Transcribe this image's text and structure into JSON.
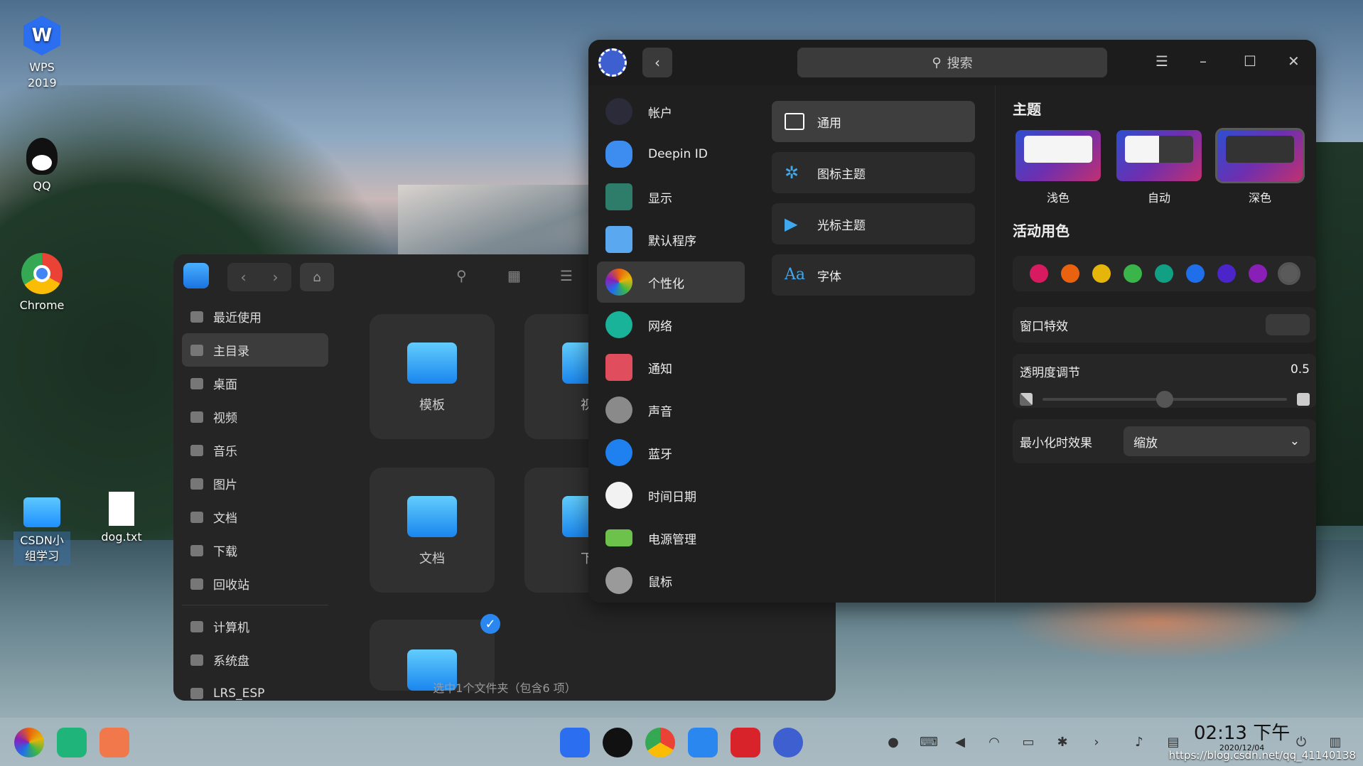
{
  "desktop": {
    "icons": [
      {
        "label": "WPS 2019"
      },
      {
        "label": "QQ"
      },
      {
        "label": "Chrome"
      },
      {
        "label": "CSDN小组学习"
      },
      {
        "label": "dog.txt"
      }
    ]
  },
  "file_manager": {
    "sidebar": [
      {
        "label": "最近使用"
      },
      {
        "label": "主目录"
      },
      {
        "label": "桌面"
      },
      {
        "label": "视频"
      },
      {
        "label": "音乐"
      },
      {
        "label": "图片"
      },
      {
        "label": "文档"
      },
      {
        "label": "下载"
      },
      {
        "label": "回收站"
      },
      {
        "label": "计算机"
      },
      {
        "label": "系统盘"
      },
      {
        "label": "LRS_ESP"
      }
    ],
    "items": [
      {
        "label": "模板"
      },
      {
        "label": "视"
      },
      {
        "label": "文档"
      },
      {
        "label": "下"
      }
    ],
    "status": "选中1个文件夹（包含6 项）"
  },
  "control_center": {
    "search_placeholder": "搜索",
    "nav": [
      {
        "label": "帐户"
      },
      {
        "label": "Deepin ID"
      },
      {
        "label": "显示"
      },
      {
        "label": "默认程序"
      },
      {
        "label": "个性化"
      },
      {
        "label": "网络"
      },
      {
        "label": "通知"
      },
      {
        "label": "声音"
      },
      {
        "label": "蓝牙"
      },
      {
        "label": "时间日期"
      },
      {
        "label": "电源管理"
      },
      {
        "label": "鼠标"
      }
    ],
    "sub_nav": [
      {
        "label": "通用"
      },
      {
        "label": "图标主题"
      },
      {
        "label": "光标主题"
      },
      {
        "label": "字体",
        "icon_text": "Aa"
      }
    ],
    "theme": {
      "heading": "主题",
      "options": [
        {
          "label": "浅色"
        },
        {
          "label": "自动"
        },
        {
          "label": "深色"
        }
      ],
      "selected": "深色"
    },
    "accent": {
      "heading": "活动用色",
      "colors": [
        "#d81b60",
        "#e8620f",
        "#e5b50a",
        "#3ab54a",
        "#12a084",
        "#1f6fea",
        "#4b25c9",
        "#8a1fb8",
        "#5a5a5a"
      ],
      "selected": "#5a5a5a"
    },
    "window_effect": {
      "label": "窗口特效",
      "enabled": false
    },
    "transparency": {
      "label": "透明度调节",
      "value": "0.5"
    },
    "minimize": {
      "label": "最小化时效果",
      "value": "缩放"
    }
  },
  "taskbar": {
    "time": "02:13 下午",
    "date": "2020/12/04"
  },
  "watermark": "https://blog.csdn.net/qq_41140138"
}
